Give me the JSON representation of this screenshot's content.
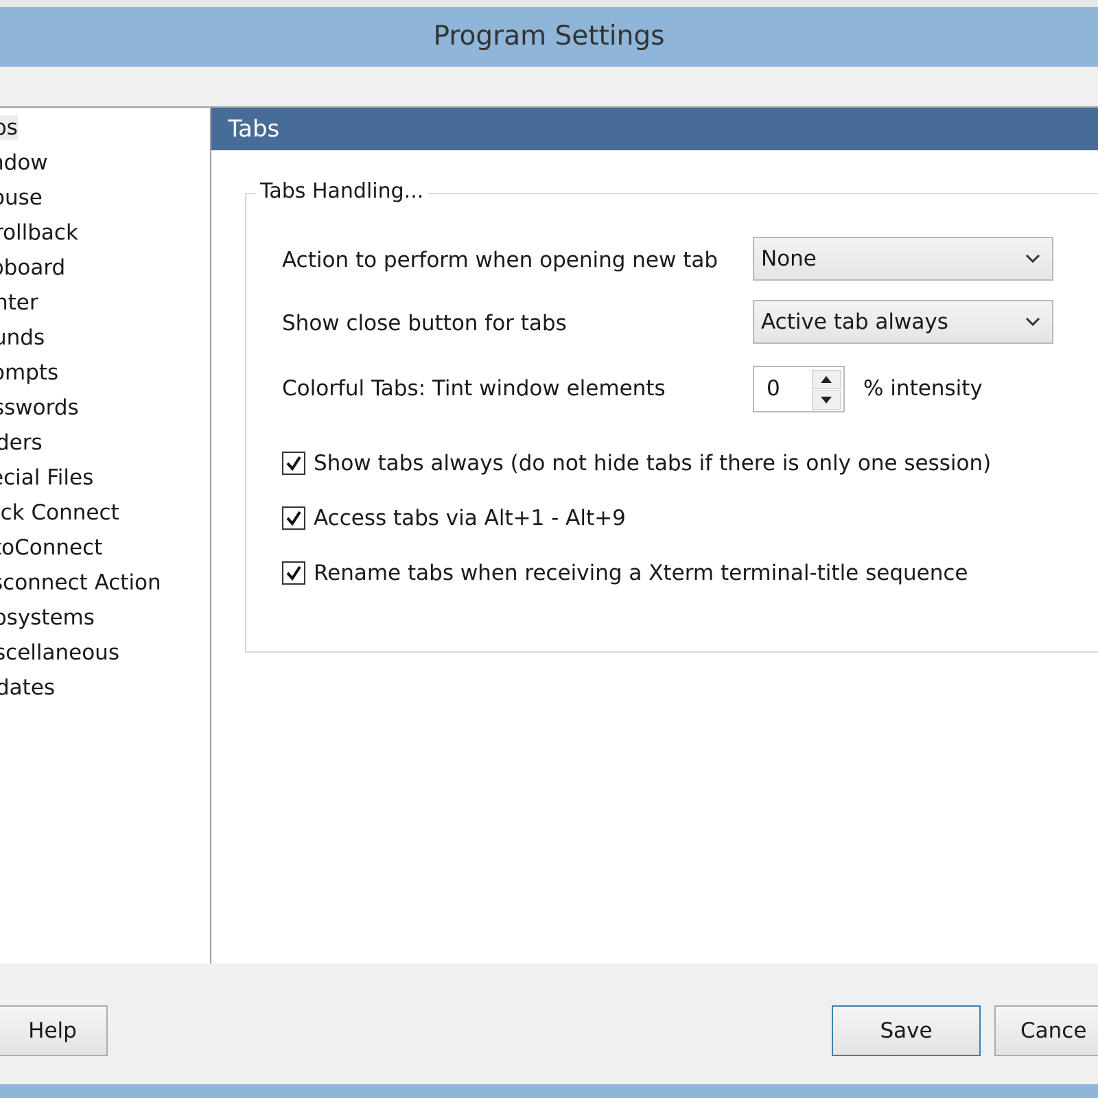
{
  "window": {
    "title": "Program Settings"
  },
  "sidebar": {
    "items": [
      {
        "label": "bs"
      },
      {
        "label": "ndow"
      },
      {
        "label": "ouse"
      },
      {
        "label": "rollback"
      },
      {
        "label": "pboard"
      },
      {
        "label": "nter"
      },
      {
        "label": "unds"
      },
      {
        "label": "ompts"
      },
      {
        "label": "sswords"
      },
      {
        "label": "ders"
      },
      {
        "label": "ecial Files"
      },
      {
        "label": "ick Connect"
      },
      {
        "label": "toConnect"
      },
      {
        "label": "sconnect Action"
      },
      {
        "label": "bsystems"
      },
      {
        "label": "scellaneous"
      },
      {
        "label": "dates"
      }
    ],
    "selected_index": 0
  },
  "content": {
    "section_title": "Tabs",
    "group": {
      "title": "Tabs Handling...",
      "new_tab_action": {
        "label": "Action to perform when opening new tab",
        "value": "None"
      },
      "close_button": {
        "label": "Show close button for tabs",
        "value": "Active tab always"
      },
      "tint": {
        "label": "Colorful Tabs: Tint window elements",
        "value": "0",
        "suffix": "% intensity"
      },
      "checkboxes": [
        {
          "label": "Show tabs always (do not hide tabs if there is only one session)",
          "checked": true
        },
        {
          "label": "Access tabs via Alt+1 - Alt+9",
          "checked": true
        },
        {
          "label": "Rename tabs when receiving a Xterm terminal-title sequence",
          "checked": true
        }
      ]
    }
  },
  "footer": {
    "help_label": "Help",
    "save_label": "Save",
    "cancel_label": "Cance"
  }
}
